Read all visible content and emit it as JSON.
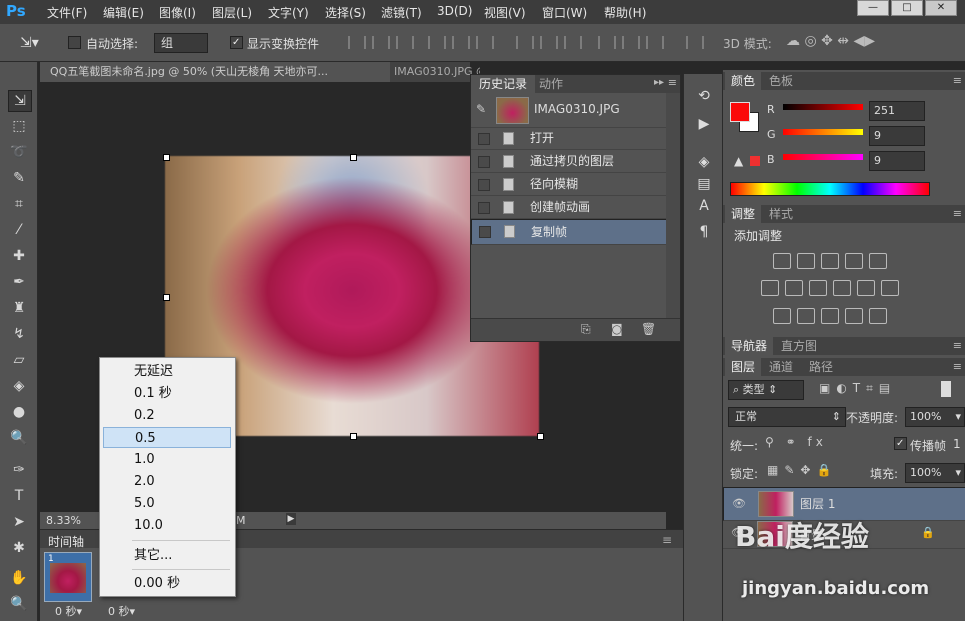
{
  "app": {
    "logo": "Ps"
  },
  "menu": [
    "文件(F)",
    "编辑(E)",
    "图像(I)",
    "图层(L)",
    "文字(Y)",
    "选择(S)",
    "滤镜(T)",
    "3D(D)",
    "视图(V)",
    "窗口(W)",
    "帮助(H)"
  ],
  "window_buttons": [
    "—",
    "□",
    "✕"
  ],
  "options": {
    "auto_select_label": "自动选择:",
    "auto_select_value": "组",
    "show_transform_label": "显示变换控件",
    "mode_3d_label": "3D 模式:"
  },
  "doc_tabs": [
    "QQ五笔截图未命名.jpg @ 50% (天山无棱角 天地亦可...",
    "IMAG0310.JPG @ 8.33% (图层 1, RGB/8) *"
  ],
  "status": {
    "zoom": "8.33%",
    "extra": "M"
  },
  "timeline": {
    "tab": "时间轴",
    "frames": [
      {
        "number": "1",
        "delay": "0 秒▾"
      },
      {
        "number": "",
        "delay": "0 秒▾"
      }
    ]
  },
  "history": {
    "tabs": [
      "历史记录",
      "动作"
    ],
    "snapshot": "IMAG0310.JPG",
    "items": [
      "打开",
      "通过拷贝的图层",
      "径向模糊",
      "创建帧动画",
      "复制帧"
    ]
  },
  "color_panel": {
    "tabs": [
      "颜色",
      "色板"
    ],
    "channels": [
      {
        "label": "R",
        "value": "251"
      },
      {
        "label": "G",
        "value": "9"
      },
      {
        "label": "B",
        "value": "9"
      }
    ],
    "foreground": "#fb0909"
  },
  "adjust_panel": {
    "tabs": [
      "调整",
      "样式"
    ],
    "title": "添加调整"
  },
  "nav_panel": {
    "tabs": [
      "导航器",
      "直方图"
    ]
  },
  "layers_panel": {
    "tabs": [
      "图层",
      "通道",
      "路径"
    ],
    "filter": "类型",
    "blend_mode": "正常",
    "opacity_label": "不透明度:",
    "opacity": "100%",
    "unify_label": "统一:",
    "propagate_label": "传播帧",
    "propagate_value": "1",
    "lock_label": "锁定:",
    "fill_label": "填充:",
    "fill": "100%",
    "layers": [
      {
        "name": "图层 1"
      },
      {
        "name": "背景"
      }
    ]
  },
  "dropdown": {
    "items": [
      "无延迟",
      "0.1 秒",
      "0.2",
      "0.5",
      "1.0",
      "2.0",
      "5.0",
      "10.0",
      "其它...",
      "0.00 秒"
    ],
    "selected": "0.5"
  },
  "watermark": {
    "logo": "Bai度经验",
    "url": "jingyan.baidu.com"
  }
}
